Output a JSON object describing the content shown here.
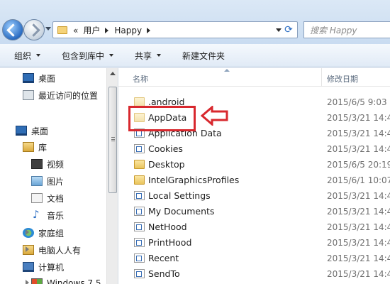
{
  "address_bar": {
    "path_prefix": "«",
    "segments": [
      "用户",
      "Happy"
    ],
    "search_placeholder": "搜索 Happy"
  },
  "toolbar": {
    "items": [
      {
        "label": "组织",
        "has_dropdown": true
      },
      {
        "label": "包含到库中",
        "has_dropdown": true
      },
      {
        "label": "共享",
        "has_dropdown": true
      },
      {
        "label": "新建文件夹",
        "has_dropdown": false
      }
    ]
  },
  "nav_pane": {
    "items": [
      {
        "label": "桌面",
        "icon": "desktop-icon"
      },
      {
        "label": "最近访问的位置",
        "icon": "recent-places-icon"
      },
      {
        "label": "桌面",
        "icon": "desktop-icon"
      },
      {
        "label": "库",
        "icon": "library-icon"
      },
      {
        "label": "视频",
        "icon": "video-library-icon"
      },
      {
        "label": "图片",
        "icon": "pictures-library-icon"
      },
      {
        "label": "文档",
        "icon": "documents-library-icon"
      },
      {
        "label": "音乐",
        "icon": "music-library-icon"
      },
      {
        "label": "家庭组",
        "icon": "homegroup-icon"
      },
      {
        "label": "电脑人人有",
        "icon": "user-folder-icon"
      },
      {
        "label": "计算机",
        "icon": "computer-icon"
      },
      {
        "label": "Windows 7 5",
        "icon": "windows-drive-icon"
      }
    ]
  },
  "file_list": {
    "columns": {
      "name": "名称",
      "date": "修改日期"
    },
    "rows": [
      {
        "name": ".android",
        "date": "2015/6/5 9:03",
        "type": "folder"
      },
      {
        "name": "AppData",
        "date": "2015/3/21 14:4",
        "type": "folder-hidden"
      },
      {
        "name": "Application Data",
        "date": "2015/3/21 14:4",
        "type": "link"
      },
      {
        "name": "Cookies",
        "date": "2015/3/21 14:4",
        "type": "link"
      },
      {
        "name": "Desktop",
        "date": "2015/6/5 20:19",
        "type": "folder"
      },
      {
        "name": "IntelGraphicsProfiles",
        "date": "2015/6/1 10:07",
        "type": "folder"
      },
      {
        "name": "Local Settings",
        "date": "2015/3/21 14:4",
        "type": "link"
      },
      {
        "name": "My Documents",
        "date": "2015/3/21 14:4",
        "type": "link"
      },
      {
        "name": "NetHood",
        "date": "2015/3/21 14:4",
        "type": "link"
      },
      {
        "name": "PrintHood",
        "date": "2015/3/21 14:4",
        "type": "link"
      },
      {
        "name": "Recent",
        "date": "2015/3/21 14:4",
        "type": "link"
      },
      {
        "name": "SendTo",
        "date": "2015/3/21 14:4",
        "type": "link"
      }
    ]
  },
  "annotation": {
    "highlight_color": "#d8282e"
  }
}
